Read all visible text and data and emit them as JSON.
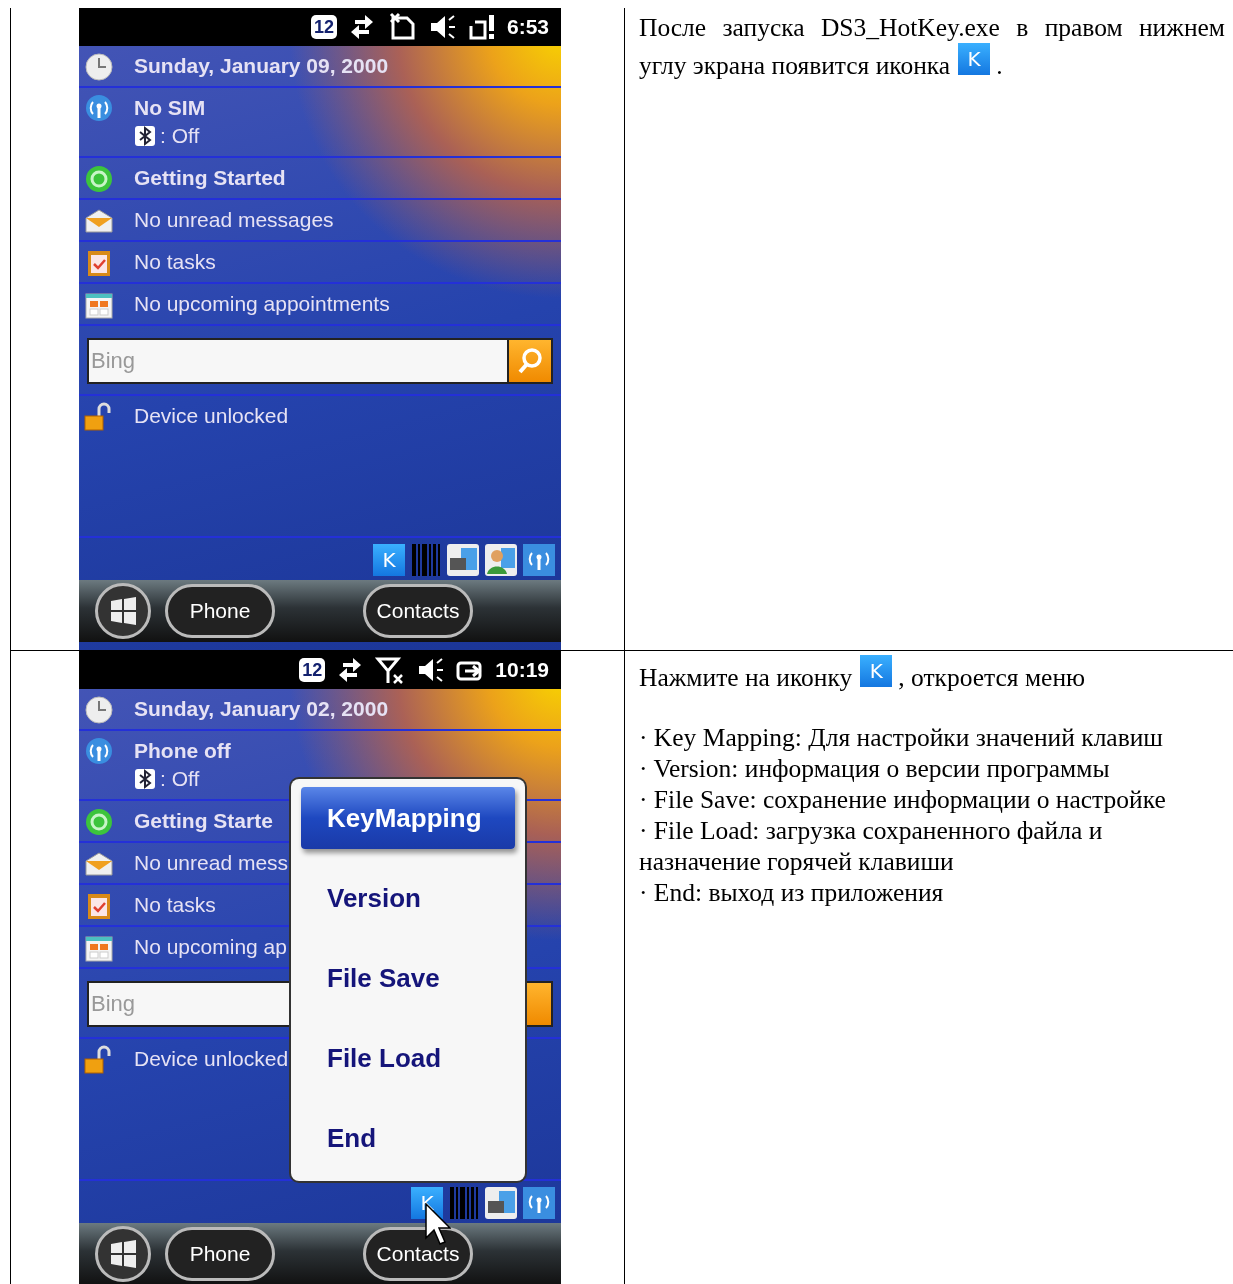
{
  "rows": [
    {
      "screen": {
        "status_bar": {
          "badge": "12",
          "icons": [
            {
              "kind": "sync"
            },
            {
              "kind": "no-sim"
            },
            {
              "kind": "speaker"
            },
            {
              "kind": "battery-alert"
            }
          ],
          "time": "6:53"
        },
        "today_items": [
          {
            "kind": "date",
            "title": "Sunday, January 09, 2000"
          },
          {
            "kind": "phone",
            "title": "No SIM",
            "bluetooth": ": Off"
          },
          {
            "kind": "getting-started",
            "title": "Getting Started"
          },
          {
            "kind": "messages",
            "title": "No unread messages"
          },
          {
            "kind": "tasks",
            "title": "No tasks"
          },
          {
            "kind": "appointments",
            "title": "No upcoming appointments"
          }
        ],
        "search": {
          "placeholder": "Bing"
        },
        "lock_item": {
          "title": "Device unlocked"
        },
        "tray": [
          {
            "kind": "k",
            "label": "K"
          },
          {
            "kind": "barcode"
          },
          {
            "kind": "device-picture"
          },
          {
            "kind": "person-picture"
          },
          {
            "kind": "antenna"
          }
        ],
        "softkeys": [
          "Phone",
          "Contacts"
        ]
      },
      "description": {
        "before": [
          "После запуска DS3_HotKey.exe в правом нижнем",
          "углу экрана появится иконка"
        ],
        "icon_label": "K",
        "after": "."
      }
    },
    {
      "screen": {
        "status_bar": {
          "badge": "12",
          "icons": [
            {
              "kind": "sync"
            },
            {
              "kind": "signal-off"
            },
            {
              "kind": "speaker"
            },
            {
              "kind": "charging"
            }
          ],
          "time": "10:19"
        },
        "today_items": [
          {
            "kind": "date",
            "title": "Sunday, January 02, 2000"
          },
          {
            "kind": "phone",
            "title": "Phone off",
            "bluetooth": ": Off"
          },
          {
            "kind": "getting-started",
            "title": "Getting Starte"
          },
          {
            "kind": "messages",
            "title": "No unread mess"
          },
          {
            "kind": "tasks",
            "title": "No tasks"
          },
          {
            "kind": "appointments",
            "title": "No upcoming ap"
          }
        ],
        "search": {
          "placeholder": "Bing",
          "button_covered": true
        },
        "lock_item": {
          "title": "Device unlocked"
        },
        "tray": [
          {
            "kind": "k",
            "label": "K"
          },
          {
            "kind": "barcode"
          },
          {
            "kind": "device-picture"
          },
          {
            "kind": "antenna"
          }
        ],
        "softkeys": [
          "Phone",
          "Contacts"
        ],
        "pointer": true,
        "menu": {
          "items": [
            {
              "label": "KeyMapping",
              "selected": true
            },
            {
              "label": "Version",
              "selected": false
            },
            {
              "label": "File Save",
              "selected": false
            },
            {
              "label": "File Load",
              "selected": false
            },
            {
              "label": "End",
              "selected": false
            }
          ]
        }
      },
      "description": {
        "before": [
          "Нажмите на иконку"
        ],
        "icon_label": "K",
        "after": ", откроется меню",
        "lines": [
          "· Key Mapping: Для настройки значений клавиш",
          "· Version: информация о версии программы",
          "· File Save: сохранение информации о настройке",
          "· File Load: загрузка сохраненного файла и назначение горячей клавиши",
          "· End: выход из приложения"
        ]
      }
    }
  ]
}
